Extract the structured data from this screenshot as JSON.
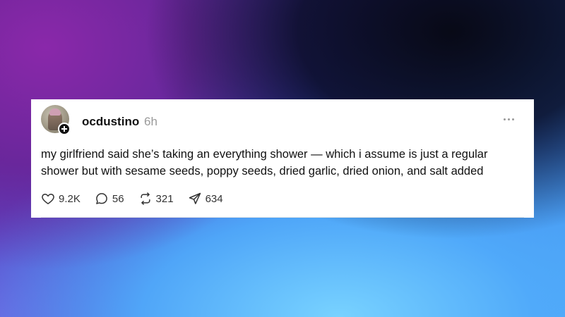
{
  "post": {
    "username": "ocdustino",
    "time": "6h",
    "text": "my girlfriend said she’s taking an everything shower — which i assume is just a regular shower but with sesame seeds, poppy seeds, dried garlic, dried onion, and salt added",
    "actions": {
      "likes": "9.2K",
      "replies": "56",
      "reposts": "321",
      "shares": "634"
    },
    "icons": {
      "avatar": "user-avatar",
      "follow": "plus-icon",
      "more": "more-options-icon",
      "like": "heart-icon",
      "reply": "comment-icon",
      "repost": "repost-icon",
      "share": "send-icon"
    }
  }
}
